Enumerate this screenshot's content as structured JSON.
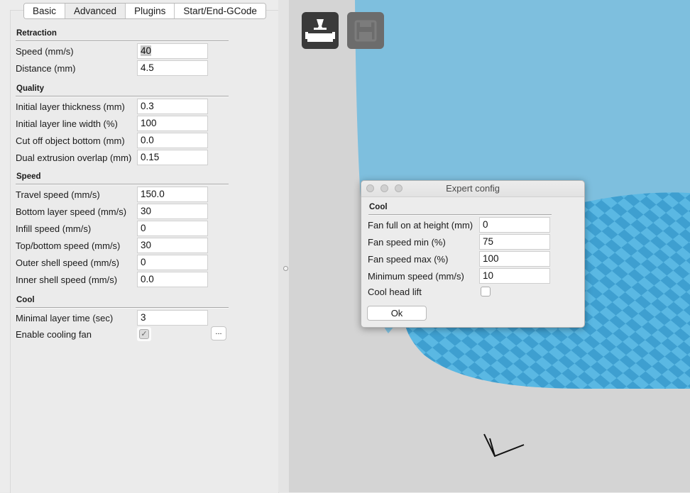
{
  "tabs": [
    "Basic",
    "Advanced",
    "Plugins",
    "Start/End-GCode"
  ],
  "active_tab": "Advanced",
  "sections": {
    "retraction": {
      "title": "Retraction",
      "rows": [
        {
          "label": "Speed (mm/s)",
          "value": "40"
        },
        {
          "label": "Distance (mm)",
          "value": "4.5"
        }
      ]
    },
    "quality": {
      "title": "Quality",
      "rows": [
        {
          "label": "Initial layer thickness (mm)",
          "value": "0.3"
        },
        {
          "label": "Initial layer line width (%)",
          "value": "100"
        },
        {
          "label": "Cut off object bottom (mm)",
          "value": "0.0"
        },
        {
          "label": "Dual extrusion overlap (mm)",
          "value": "0.15"
        }
      ]
    },
    "speed": {
      "title": "Speed",
      "rows": [
        {
          "label": "Travel speed (mm/s)",
          "value": "150.0"
        },
        {
          "label": "Bottom layer speed (mm/s)",
          "value": "30"
        },
        {
          "label": "Infill speed (mm/s)",
          "value": "0"
        },
        {
          "label": "Top/bottom speed (mm/s)",
          "value": "30"
        },
        {
          "label": "Outer shell speed (mm/s)",
          "value": "0"
        },
        {
          "label": "Inner shell speed (mm/s)",
          "value": "0.0"
        }
      ]
    },
    "cool": {
      "title": "Cool",
      "min_layer_time_label": "Minimal layer time (sec)",
      "min_layer_time_value": "3",
      "fan_label": "Enable cooling fan",
      "fan_checked": true,
      "more_label": "..."
    }
  },
  "dialog": {
    "title": "Expert config",
    "section": "Cool",
    "rows": [
      {
        "label": "Fan full on at height (mm)",
        "value": "0"
      },
      {
        "label": "Fan speed min (%)",
        "value": "75"
      },
      {
        "label": "Fan speed max (%)",
        "value": "100"
      },
      {
        "label": "Minimum speed (mm/s)",
        "value": "10"
      }
    ],
    "head_lift_label": "Cool head lift",
    "head_lift_checked": false,
    "ok_label": "Ok"
  },
  "toolbar": {
    "load_icon": "load-model-icon",
    "save_icon": "save-floppy-icon"
  },
  "colors": {
    "viewport_bg": "#d4d4d4",
    "build_volume": "#7ebfde",
    "bed_light": "#5ab8e3",
    "bed_dark": "#3e9fd0"
  },
  "checkmark_glyph": "✓"
}
